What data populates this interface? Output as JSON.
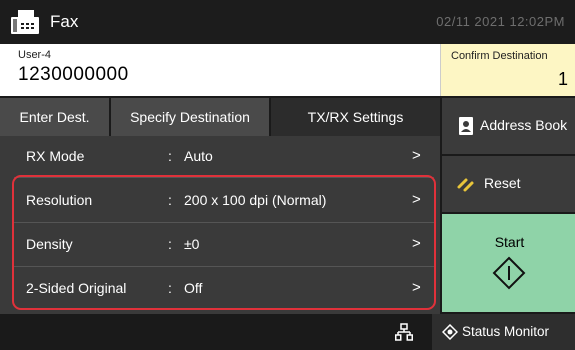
{
  "header": {
    "app_title": "Fax",
    "datetime": "02/11 2021 12:02PM",
    "icon": "fax-icon"
  },
  "destination": {
    "user": "User-4",
    "number": "1230000000"
  },
  "confirm": {
    "label": "Confirm Destination",
    "count": "1"
  },
  "tabs": [
    {
      "label": "Enter Dest.",
      "active": false
    },
    {
      "label": "Specify Destination",
      "active": false
    },
    {
      "label": "TX/RX Settings",
      "active": true
    }
  ],
  "settings": [
    {
      "label": "RX Mode",
      "colon": ":",
      "value": "Auto",
      "chevron": ">"
    },
    {
      "label": "Resolution",
      "colon": ":",
      "value": "200 x 100 dpi (Normal)",
      "chevron": ">"
    },
    {
      "label": "Density",
      "colon": ":",
      "value": "±0",
      "chevron": ">"
    },
    {
      "label": "2-Sided Original",
      "colon": ":",
      "value": "Off",
      "chevron": ">"
    }
  ],
  "side": {
    "address_book": "Address Book",
    "reset": "Reset",
    "start": "Start"
  },
  "footer": {
    "status_monitor": "Status Monitor"
  },
  "colors": {
    "highlight": "#e0313a",
    "start": "#8fd3a8",
    "confirm": "#fdf6c4"
  }
}
